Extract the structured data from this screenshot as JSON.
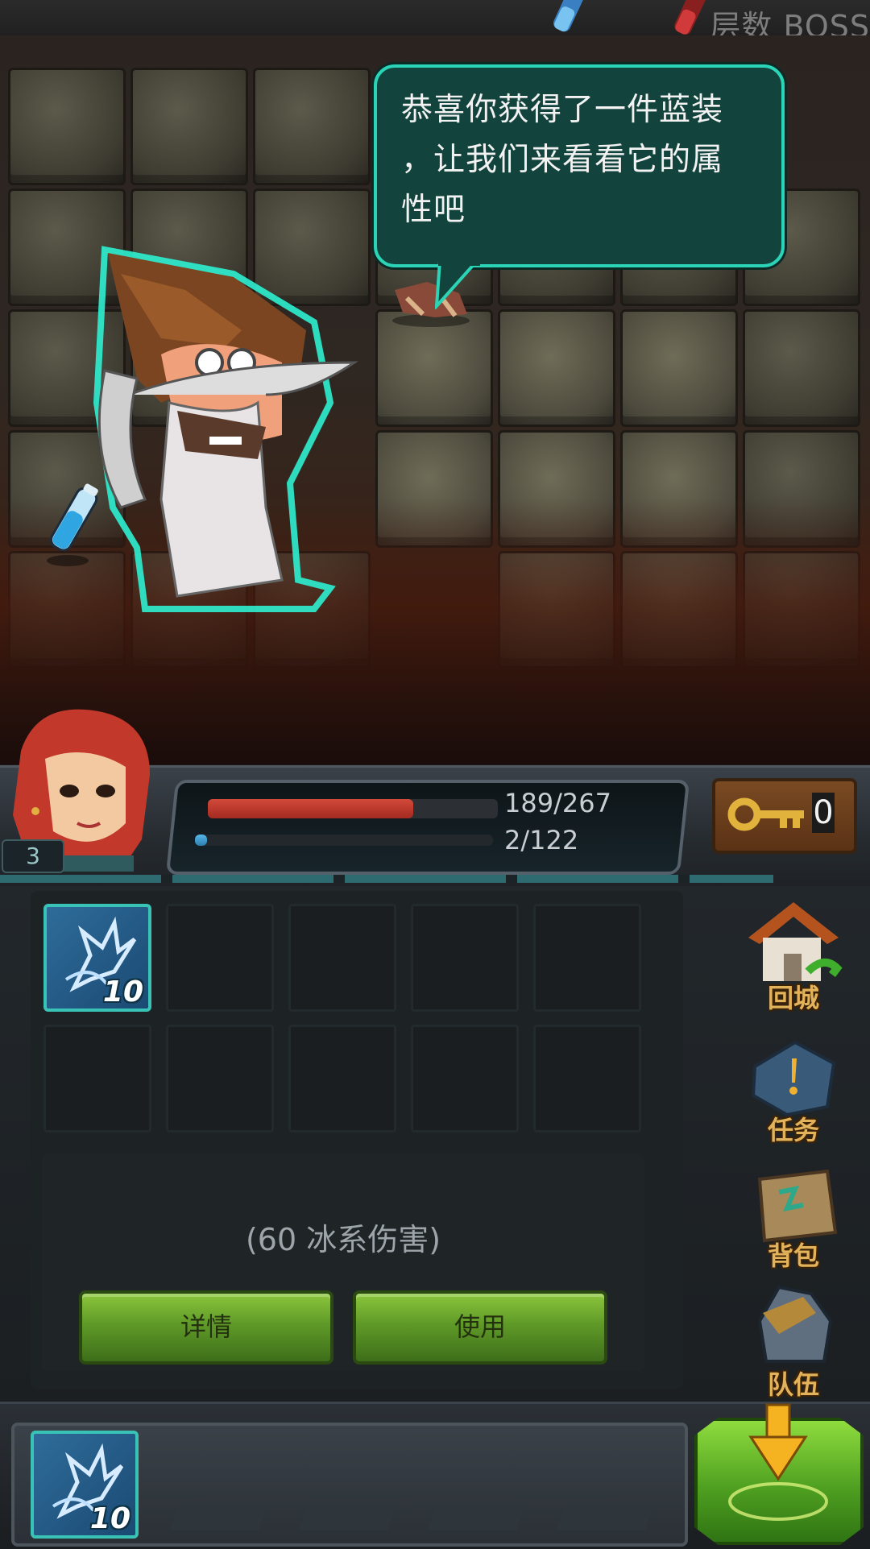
{
  "top_bar": {
    "floor_label": "层数 BOSS"
  },
  "dialog": {
    "speaker": "wizard",
    "line1": "恭喜你获得了一件蓝装",
    "line2": "，让我们来看看它的属",
    "line3": "性吧"
  },
  "hero": {
    "level": "3",
    "hp_text": "189/267",
    "hp_current": 189,
    "hp_max": 267,
    "xp_text": "2/122",
    "xp_current": 2,
    "xp_max": 122,
    "keys": "0"
  },
  "inventory": {
    "item_count": "10",
    "item_desc": "(60 冰系伤害)",
    "detail_button": "详情",
    "use_button": "使用"
  },
  "side_menu": {
    "town": "回城",
    "quests": "任务",
    "backpack": "背包",
    "team": "队伍"
  },
  "quick_bar": {
    "item_count": "10"
  },
  "colors": {
    "bubble_bg": "#12443d",
    "bubble_border": "#2bd4b6",
    "hp": "#d24a3a",
    "xp": "#58b7e8",
    "button_green": "#5f9a28",
    "menu_label": "#e2b35a"
  }
}
